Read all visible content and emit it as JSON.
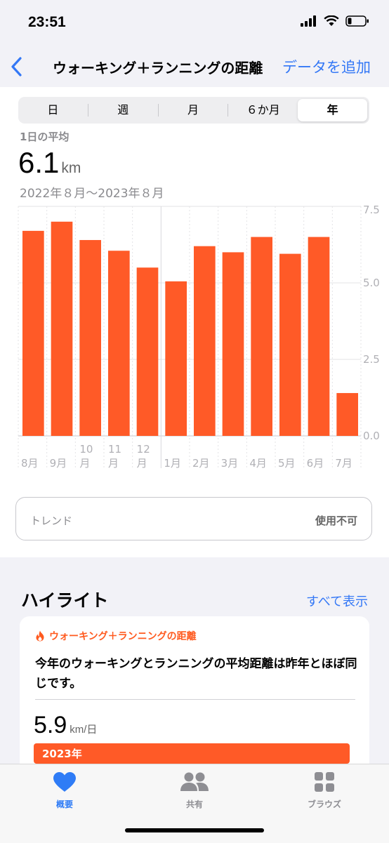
{
  "status_bar": {
    "time": "23:51"
  },
  "nav": {
    "title": "ウォーキング＋ランニングの距離",
    "add_label": "データを追加"
  },
  "segments": [
    "日",
    "週",
    "月",
    "６か月",
    "年"
  ],
  "selected_segment": "年",
  "summary": {
    "avg_label": "1日の平均",
    "value": "6.1",
    "unit": "km",
    "range": "2022年８月〜2023年８月"
  },
  "chart_data": {
    "type": "bar",
    "categories": [
      "8月",
      "9月",
      "10月",
      "11月",
      "12月",
      "1月",
      "2月",
      "3月",
      "4月",
      "5月",
      "6月",
      "7月"
    ],
    "values": [
      6.7,
      7.0,
      6.4,
      6.05,
      5.5,
      5.05,
      6.2,
      6.0,
      6.5,
      5.95,
      6.5,
      1.4
    ],
    "ylim": [
      0,
      7.5
    ],
    "yticks": [
      "7.5",
      "5.0",
      "2.5",
      "0.0"
    ],
    "bar_color": "#ff5a27",
    "grid": true
  },
  "trend": {
    "label": "トレンド",
    "value": "使用不可"
  },
  "highlights": {
    "title": "ハイライト",
    "show_all": "すべて表示",
    "card": {
      "category": "ウォーキング＋ランニングの距離",
      "description": "今年のウォーキングとランニングの平均距離は昨年とほぼ同じです。",
      "value": "5.9",
      "unit": "km/日",
      "bar_label": "2023年",
      "accent": "#ff5a27"
    }
  },
  "tabs": [
    {
      "label": "概要",
      "icon": "heart-icon",
      "active": true
    },
    {
      "label": "共有",
      "icon": "people-icon",
      "active": false
    },
    {
      "label": "ブラウズ",
      "icon": "grid-icon",
      "active": false
    }
  ]
}
